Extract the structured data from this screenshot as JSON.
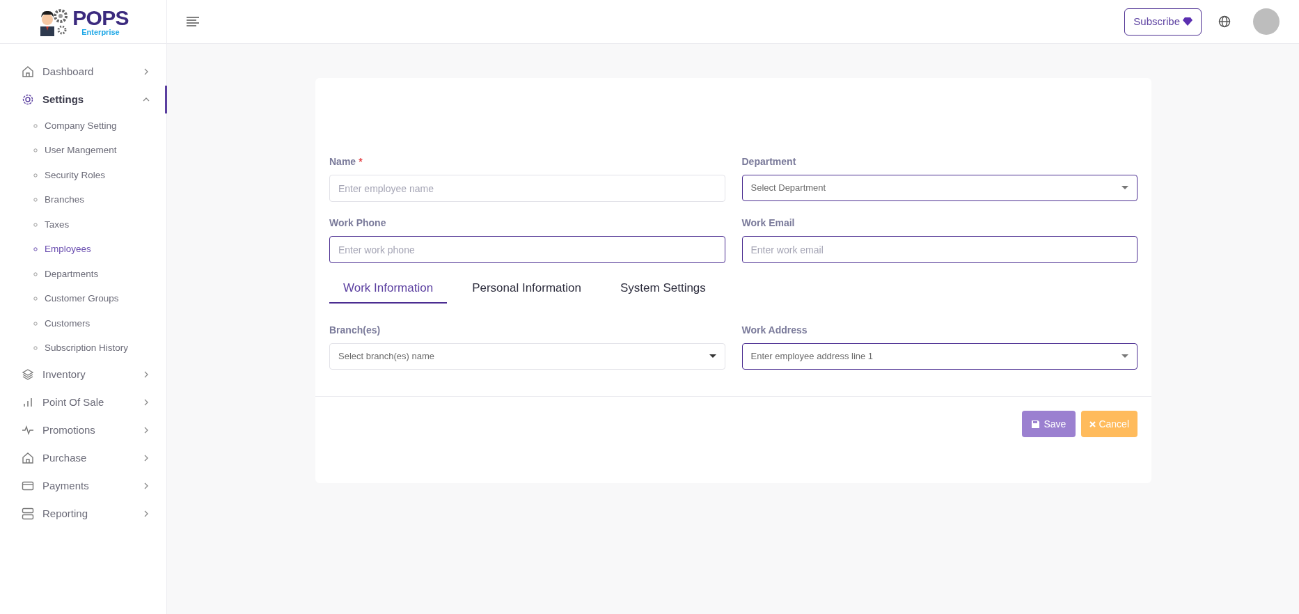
{
  "logo": {
    "title": "POPS",
    "subtitle": "Enterprise"
  },
  "header": {
    "subscribe": "Subscribe"
  },
  "sidebar": {
    "items": [
      {
        "label": "Dashboard",
        "expanded": false,
        "selected": false
      },
      {
        "label": "Settings",
        "expanded": true,
        "selected": true,
        "children": [
          {
            "label": "Company Setting",
            "selected": false
          },
          {
            "label": "User Mangement",
            "selected": false
          },
          {
            "label": "Security Roles",
            "selected": false
          },
          {
            "label": "Branches",
            "selected": false
          },
          {
            "label": "Taxes",
            "selected": false
          },
          {
            "label": "Employees",
            "selected": true
          },
          {
            "label": "Departments",
            "selected": false
          },
          {
            "label": "Customer Groups",
            "selected": false
          },
          {
            "label": "Customers",
            "selected": false
          },
          {
            "label": "Subscription History",
            "selected": false
          }
        ]
      },
      {
        "label": "Inventory",
        "expanded": false,
        "selected": false
      },
      {
        "label": "Point Of Sale",
        "expanded": false,
        "selected": false
      },
      {
        "label": "Promotions",
        "expanded": false,
        "selected": false
      },
      {
        "label": "Purchase",
        "expanded": false,
        "selected": false
      },
      {
        "label": "Payments",
        "expanded": false,
        "selected": false
      },
      {
        "label": "Reporting",
        "expanded": false,
        "selected": false
      }
    ]
  },
  "form": {
    "top_fields": [
      {
        "kind": "input",
        "label": "Name",
        "required_mark": "*",
        "placeholder": "Enter employee name",
        "accented": false
      },
      {
        "kind": "select",
        "label": "Department",
        "placeholder": "Select Department",
        "accented": true
      },
      {
        "kind": "input",
        "label": "Work Phone",
        "placeholder": "Enter work phone",
        "accented": true
      },
      {
        "kind": "input",
        "label": "Work Email",
        "placeholder": "Enter work email",
        "accented": true
      }
    ],
    "tabs": [
      {
        "label": "Work Information",
        "selected": true
      },
      {
        "label": "Personal Information",
        "selected": false
      },
      {
        "label": "System Settings",
        "selected": false
      }
    ],
    "tab_fields": [
      {
        "kind": "select",
        "label": "Branch(es)",
        "placeholder": "Select branch(es) name",
        "accented": false
      },
      {
        "kind": "select",
        "label": "Work Address",
        "placeholder": "Enter employee address line 1",
        "accented": true
      }
    ],
    "buttons": [
      {
        "kind": "save",
        "label": "Save"
      },
      {
        "kind": "cancel",
        "label": "Cancel"
      }
    ]
  }
}
